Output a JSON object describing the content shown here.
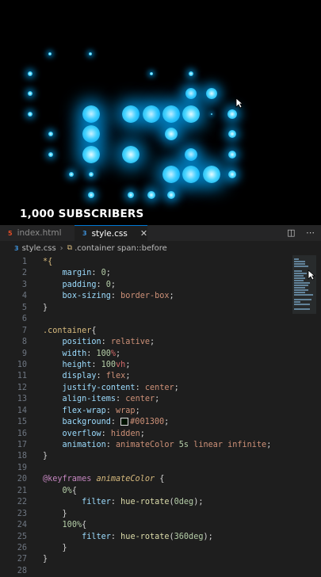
{
  "preview": {
    "caption": "1,000 SUBSCRIBERS",
    "background": "#000000",
    "glow_color": "#00bfff"
  },
  "tabs": [
    {
      "label": "index.html",
      "icon": "html5-icon",
      "active": false
    },
    {
      "label": "style.css",
      "icon": "css3-icon",
      "active": true
    }
  ],
  "breadcrumb": {
    "file": "style.css",
    "selector": ".container span::before"
  },
  "code": {
    "lines": [
      {
        "n": "1",
        "tokens": [
          [
            "sel",
            "*{"
          ]
        ]
      },
      {
        "n": "2",
        "tokens": [
          [
            "txt",
            "    "
          ],
          [
            "prop",
            "margin"
          ],
          [
            "punc",
            ": "
          ],
          [
            "num",
            "0"
          ],
          [
            "punc",
            ";"
          ]
        ]
      },
      {
        "n": "3",
        "tokens": [
          [
            "txt",
            "    "
          ],
          [
            "prop",
            "padding"
          ],
          [
            "punc",
            ": "
          ],
          [
            "num",
            "0"
          ],
          [
            "punc",
            ";"
          ]
        ]
      },
      {
        "n": "4",
        "tokens": [
          [
            "txt",
            "    "
          ],
          [
            "prop",
            "box-sizing"
          ],
          [
            "punc",
            ": "
          ],
          [
            "val",
            "border-box"
          ],
          [
            "punc",
            ";"
          ]
        ]
      },
      {
        "n": "5",
        "tokens": [
          [
            "punc",
            "}"
          ]
        ]
      },
      {
        "n": "6",
        "tokens": []
      },
      {
        "n": "7",
        "tokens": [
          [
            "sel",
            ".container"
          ],
          [
            "punc",
            "{"
          ]
        ]
      },
      {
        "n": "8",
        "tokens": [
          [
            "txt",
            "    "
          ],
          [
            "prop",
            "position"
          ],
          [
            "punc",
            ": "
          ],
          [
            "val",
            "relative"
          ],
          [
            "punc",
            ";"
          ]
        ]
      },
      {
        "n": "9",
        "tokens": [
          [
            "txt",
            "    "
          ],
          [
            "prop",
            "width"
          ],
          [
            "punc",
            ": "
          ],
          [
            "num",
            "100"
          ],
          [
            "unit",
            "%"
          ],
          [
            "punc",
            ";"
          ]
        ]
      },
      {
        "n": "10",
        "tokens": [
          [
            "txt",
            "    "
          ],
          [
            "prop",
            "height"
          ],
          [
            "punc",
            ": "
          ],
          [
            "num",
            "100"
          ],
          [
            "unit",
            "vh"
          ],
          [
            "punc",
            ";"
          ]
        ]
      },
      {
        "n": "11",
        "tokens": [
          [
            "txt",
            "    "
          ],
          [
            "prop",
            "display"
          ],
          [
            "punc",
            ": "
          ],
          [
            "val",
            "flex"
          ],
          [
            "punc",
            ";"
          ]
        ]
      },
      {
        "n": "12",
        "tokens": [
          [
            "txt",
            "    "
          ],
          [
            "prop",
            "justify-content"
          ],
          [
            "punc",
            ": "
          ],
          [
            "val",
            "center"
          ],
          [
            "punc",
            ";"
          ]
        ]
      },
      {
        "n": "13",
        "tokens": [
          [
            "txt",
            "    "
          ],
          [
            "prop",
            "align-items"
          ],
          [
            "punc",
            ": "
          ],
          [
            "val",
            "center"
          ],
          [
            "punc",
            ";"
          ]
        ]
      },
      {
        "n": "14",
        "tokens": [
          [
            "txt",
            "    "
          ],
          [
            "prop",
            "flex-wrap"
          ],
          [
            "punc",
            ": "
          ],
          [
            "val",
            "wrap"
          ],
          [
            "punc",
            ";"
          ]
        ]
      },
      {
        "n": "15",
        "tokens": [
          [
            "txt",
            "    "
          ],
          [
            "prop",
            "background"
          ],
          [
            "punc",
            ": "
          ],
          [
            "swatch",
            ""
          ],
          [
            "val",
            "#001300"
          ],
          [
            "punc",
            ";"
          ]
        ]
      },
      {
        "n": "16",
        "tokens": [
          [
            "txt",
            "    "
          ],
          [
            "prop",
            "overflow"
          ],
          [
            "punc",
            ": "
          ],
          [
            "val",
            "hidden"
          ],
          [
            "punc",
            ";"
          ]
        ]
      },
      {
        "n": "17",
        "tokens": [
          [
            "txt",
            "    "
          ],
          [
            "prop",
            "animation"
          ],
          [
            "punc",
            ": "
          ],
          [
            "val",
            "animateColor "
          ],
          [
            "num",
            "5s"
          ],
          [
            "val",
            " linear infinite"
          ],
          [
            "punc",
            ";"
          ]
        ]
      },
      {
        "n": "18",
        "tokens": [
          [
            "punc",
            "}"
          ]
        ]
      },
      {
        "n": "19",
        "tokens": []
      },
      {
        "n": "20",
        "tokens": [
          [
            "kw",
            "@keyframes"
          ],
          [
            "txt",
            " "
          ],
          [
            "anim",
            "animateColor"
          ],
          [
            "punc",
            " {"
          ]
        ]
      },
      {
        "n": "21",
        "tokens": [
          [
            "txt",
            "    "
          ],
          [
            "num",
            "0%"
          ],
          [
            "punc",
            "{"
          ]
        ]
      },
      {
        "n": "22",
        "tokens": [
          [
            "txt",
            "        "
          ],
          [
            "prop",
            "filter"
          ],
          [
            "punc",
            ": "
          ],
          [
            "func",
            "hue-rotate"
          ],
          [
            "punc",
            "("
          ],
          [
            "num",
            "0deg"
          ],
          [
            "punc",
            ");"
          ]
        ]
      },
      {
        "n": "23",
        "tokens": [
          [
            "txt",
            "    "
          ],
          [
            "punc",
            "}"
          ]
        ]
      },
      {
        "n": "24",
        "tokens": [
          [
            "txt",
            "    "
          ],
          [
            "num",
            "100%"
          ],
          [
            "punc",
            "{"
          ]
        ]
      },
      {
        "n": "25",
        "tokens": [
          [
            "txt",
            "        "
          ],
          [
            "prop",
            "filter"
          ],
          [
            "punc",
            ": "
          ],
          [
            "func",
            "hue-rotate"
          ],
          [
            "punc",
            "("
          ],
          [
            "num",
            "360deg"
          ],
          [
            "punc",
            ");"
          ]
        ]
      },
      {
        "n": "26",
        "tokens": [
          [
            "txt",
            "    "
          ],
          [
            "punc",
            "}"
          ]
        ]
      },
      {
        "n": "27",
        "tokens": [
          [
            "punc",
            "}"
          ]
        ]
      },
      {
        "n": "28",
        "tokens": []
      }
    ]
  }
}
